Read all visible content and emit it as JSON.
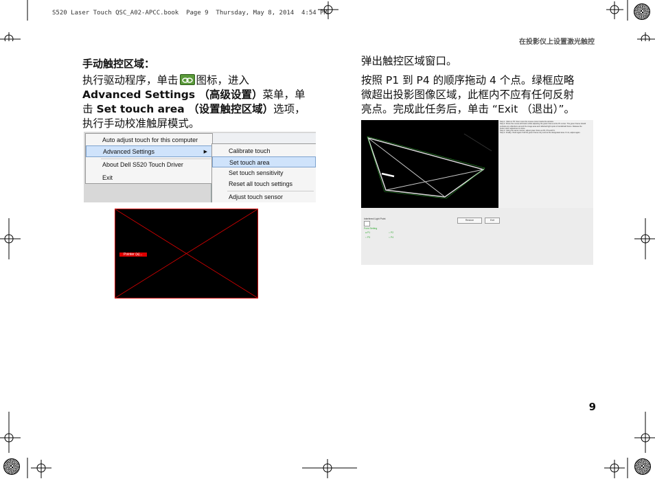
{
  "header": {
    "print_info": "S520 Laser Touch QSC_A02-APCC.book  Page 9  Thursday, May 8, 2014  4:54 PM"
  },
  "section_title": "在投影仪上设置激光触控",
  "left": {
    "heading": "手动触控区域：",
    "para": {
      "t1": "执行驱动程序，单击",
      "t2": "图标，进入",
      "b1": "Advanced Settings （高级设置）",
      "t3": "菜单，单",
      "t4": "击 ",
      "b2": "Set touch area （设置触控区域）",
      "t5": "选项，",
      "t6": "执行手动校准触屏模式。"
    },
    "menu": {
      "main_items": [
        "Auto adjust touch for this computer",
        "Advanced Settings",
        "About Dell S520 Touch Driver",
        "Exit"
      ],
      "sub_items": [
        "Calibrate touch",
        "Set touch area",
        "Set touch sensitivity",
        "Reset all touch settings",
        "Adjust touch sensor"
      ],
      "highlighted_main": "Advanced Settings",
      "highlighted_sub": "Set touch area"
    },
    "xbox_label": "Pointer (a)..."
  },
  "right": {
    "line1": "弹出触控区域窗口。",
    "para2": [
      "按照 P1 到 P4 的顺序拖动 4 个点。绿框应略",
      "微超出投影图像区域，此框内不应有任何反射",
      "亮点。完成此任务后，单击 “Exit （退出）”。"
    ],
    "screenshot": {
      "instructions": [
        "Step 1. Click on 'P1' then move the mouse cursor inside the window.",
        "Step 2. Press the mouse left button while adjusting the green frame at the P1 corner. The green frame should",
        "exclude any reflections around the image area and reflected light spots of windshield frame. Release the",
        "button when adjustment is done.",
        "Step 3. Using the same manner, adjust green frame at P2, P3 and P4.",
        "Step 4. Finally, check again if all the green frame only exist at the designated area. If not, adjust again."
      ],
      "section_label": "Interfered Light Point",
      "point_setting": "Point Setting",
      "points": [
        "P1",
        "P2",
        "P3",
        "P4"
      ],
      "buttons": [
        "Restore",
        "Exit"
      ]
    }
  },
  "page_number": "9"
}
